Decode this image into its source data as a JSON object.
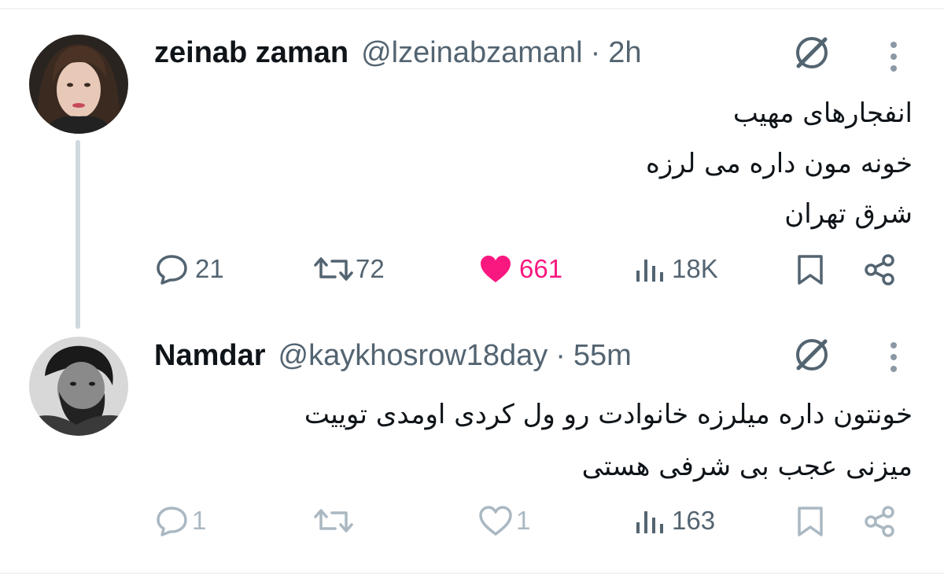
{
  "tweets": [
    {
      "display_name": "zeinab zaman",
      "handle": "@lzeinabzamanl",
      "separator": "·",
      "time": "2h",
      "text_lines": [
        "انفجارهای مهیب",
        "خونه مون داره می لرزه",
        "شرق تهران"
      ],
      "replies": "21",
      "retweets": "72",
      "likes": "661",
      "views": "18K",
      "liked": true
    },
    {
      "display_name": "Namdar",
      "handle": "@kaykhosrow18day",
      "separator": "·",
      "time": "55m",
      "text_lines": [
        "خونتون داره میلرزه خانوادت رو ول کردی اومدی توییت",
        "میزنی عجب بی شرفی هستی"
      ],
      "replies": "1",
      "retweets": "",
      "likes": "1",
      "views": "163",
      "liked": false
    }
  ],
  "icons": {
    "reply": "reply-icon",
    "retweet": "retweet-icon",
    "like": "heart-icon",
    "views": "views-icon",
    "bookmark": "bookmark-icon",
    "share": "share-icon",
    "grok": "grok-icon",
    "more": "more-icon"
  },
  "colors": {
    "text": "#0f1419",
    "secondary": "#536471",
    "like": "#f91880",
    "faded": "#aab8c2",
    "divider": "#eff3f4"
  }
}
